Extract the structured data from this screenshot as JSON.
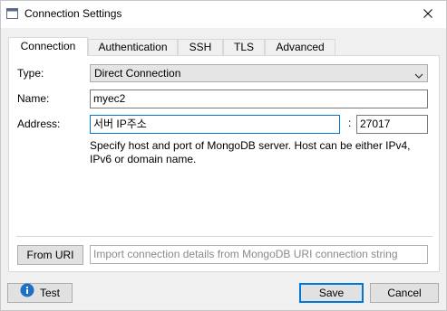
{
  "window": {
    "title": "Connection Settings"
  },
  "tabs": [
    {
      "label": "Connection"
    },
    {
      "label": "Authentication"
    },
    {
      "label": "SSH"
    },
    {
      "label": "TLS"
    },
    {
      "label": "Advanced"
    }
  ],
  "form": {
    "type_label": "Type:",
    "type_value": "Direct Connection",
    "name_label": "Name:",
    "name_value": "myec2",
    "address_label": "Address:",
    "host_value": "서버 IP주소",
    "port_separator": ":",
    "port_value": "27017",
    "help_text": "Specify host and port of MongoDB server. Host can be either IPv4, IPv6 or domain name."
  },
  "uri": {
    "button_label": "From URI",
    "placeholder": "Import connection details from MongoDB URI connection string"
  },
  "footer": {
    "test_label": "Test",
    "save_label": "Save",
    "cancel_label": "Cancel"
  },
  "icons": {
    "window": "window-icon",
    "close": "close-icon",
    "dropdown": "chevron-down-icon",
    "info": "info-icon"
  },
  "colors": {
    "accent": "#0078d7",
    "info_icon": "#1e6fc8"
  }
}
